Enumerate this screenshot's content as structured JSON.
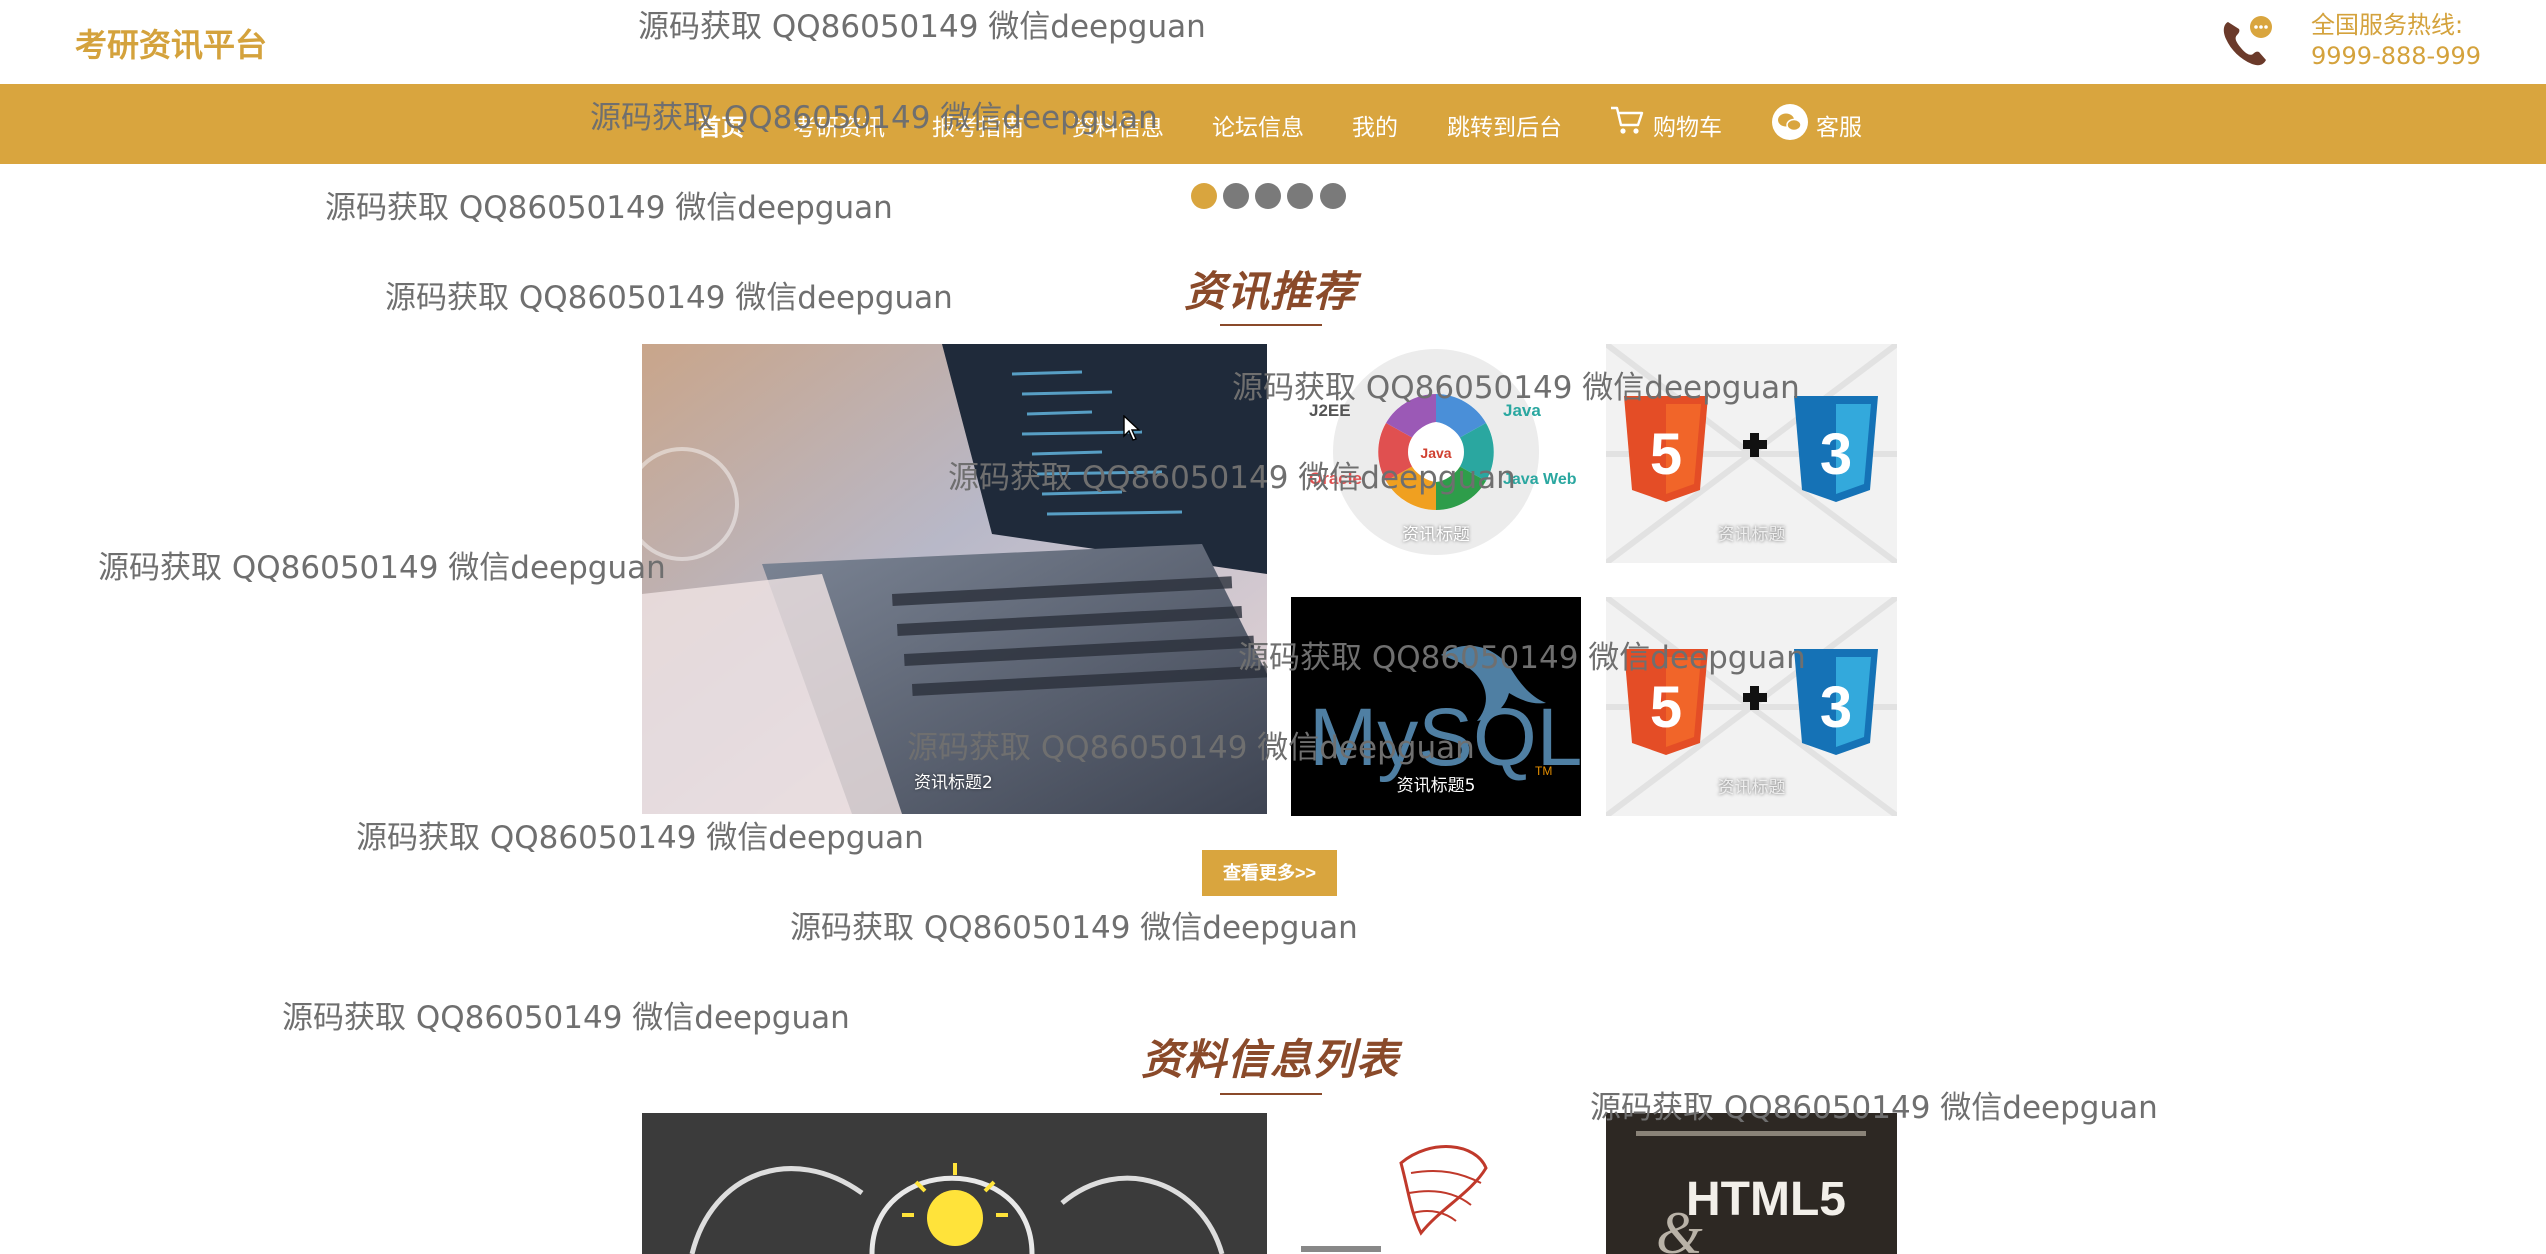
{
  "header": {
    "brand": "考研资讯平台",
    "hotline_label": "全国服务热线:",
    "hotline_number": "9999-888-999"
  },
  "nav": {
    "items": [
      {
        "label": "首页",
        "active": true
      },
      {
        "label": "考研资讯"
      },
      {
        "label": "报考指南"
      },
      {
        "label": "资料信息"
      },
      {
        "label": "论坛信息"
      },
      {
        "label": "我的"
      },
      {
        "label": "跳转到后台"
      },
      {
        "label": "购物车",
        "icon": "cart-icon"
      },
      {
        "label": "客服",
        "icon": "wechat-icon"
      }
    ]
  },
  "carousel": {
    "dot_count": 5,
    "active_index": 0
  },
  "news_section": {
    "title": "资讯推荐",
    "tiles": [
      {
        "caption": "资讯标题2",
        "image": "laptop-code-photo"
      },
      {
        "caption": "资讯标题",
        "image": "java-j2ee-diagram"
      },
      {
        "caption": "资讯标题",
        "image": "html5-css3-logos"
      },
      {
        "caption": "资讯标题5",
        "image": "mysql-logo"
      },
      {
        "caption": "资讯标题",
        "image": "html5-css3-logos"
      }
    ],
    "more_button": "查看更多>>"
  },
  "materials_section": {
    "title": "资料信息列表",
    "tiles": [
      {
        "image": "lightbulb-chalkboard"
      },
      {
        "image": "sql-server-logo"
      },
      {
        "image": "html5-css3-book-cover",
        "text": "HTML5"
      }
    ]
  },
  "diagram_labels": {
    "j2ee": "J2EE",
    "java": "Java",
    "java_web": "Java Web",
    "oracle": "Oracle",
    "html5_badge": "5",
    "css3_badge": "3",
    "mysql": "MySQL",
    "tm": "TM"
  },
  "watermark": "源码获取 QQ86050149 微信deepguan",
  "colors": {
    "accent": "#d9a53e",
    "brand_text": "#d4a23c",
    "heading": "#8a4a2a",
    "dot_inactive": "#7a7a7a"
  }
}
